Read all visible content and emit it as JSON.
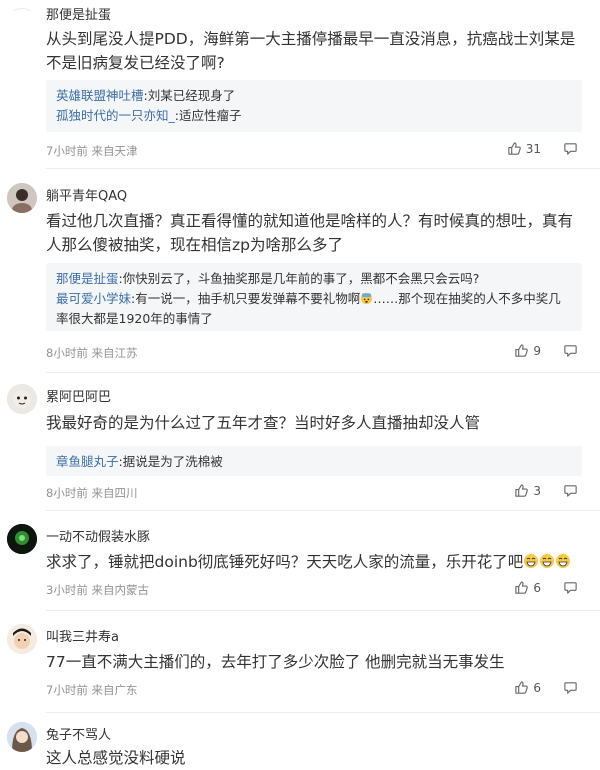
{
  "comments": [
    {
      "username": "那便是扯蛋",
      "avatar": "faded-icon",
      "content": "从头到尾没人提PDD，海鲜第一大主播停播最早一直没消息，抗癌战士刘某是不是旧病复发已经没了啊?",
      "replies": [
        {
          "user": "英雄联盟神吐槽",
          "text": ":刘某已经现身了"
        },
        {
          "user": "孤独时代的一只亦知_",
          "text": ":适应性瘤子"
        }
      ],
      "time": "7小时前",
      "location": "来自天津",
      "likes": "31"
    },
    {
      "username": "躺平青年QAQ",
      "avatar": "user-photo",
      "content": "看过他几次直播？真正看得懂的就知道他是啥样的人？有时候真的想吐，真有人那么傻被抽奖，现在相信zp为啥那么多了",
      "replies": [
        {
          "user": "那便是扯蛋",
          "text": ":你快别云了，斗鱼抽奖那是几年前的事了，黑都不会黑只会云吗?"
        },
        {
          "user": "最可爱小学妹",
          "text": ":有一说一，抽手机只要发弹幕不要礼物啊",
          "emoji": "😰",
          "text_after": "……那个现在抽奖的人不多中奖几率很大都是1920年的事情了"
        }
      ],
      "time": "8小时前",
      "location": "来自江苏",
      "likes": "9"
    },
    {
      "username": "累阿巴阿巴",
      "avatar": "user-photo",
      "content": "我最好奇的是为什么过了五年才查？当时好多人直播抽却没人管",
      "replies": [
        {
          "user": "章鱼腿丸子",
          "text": ":据说是为了洗棉被"
        }
      ],
      "time": "8小时前",
      "location": "来自四川",
      "likes": "3"
    },
    {
      "username": "一动不动假装水豚",
      "avatar": "user-photo",
      "content": "求求了，锤就把doinb彻底锤死好吗？天天吃人家的流量，乐开花了吧",
      "content_emoji": "😁😁😁",
      "replies": [],
      "time": "3小时前",
      "location": "来自内蒙古",
      "likes": "6"
    },
    {
      "username": "叫我三井寿a",
      "avatar": "user-photo",
      "content": "77一直不满大主播们的，去年打了多少次脸了 他删完就当无事发生",
      "replies": [],
      "time": "7小时前",
      "location": "来自广东",
      "likes": "6"
    },
    {
      "username": "兔子不骂人",
      "avatar": "user-photo",
      "content": "这人总感觉没料硬说",
      "replies": [],
      "time": "",
      "location": "",
      "likes": ""
    }
  ],
  "icons": {
    "like": "thumbs-up-icon",
    "reply": "comment-bubble-icon"
  },
  "colors": {
    "reply_user": "#3b6ea8",
    "meta": "#939393",
    "reply_bg": "#f5f6f8"
  }
}
